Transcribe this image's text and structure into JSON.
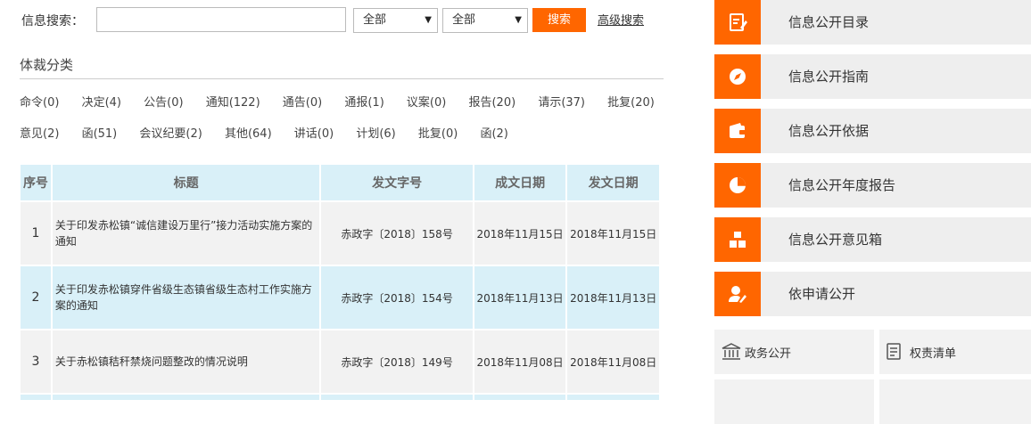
{
  "search": {
    "label": "信息搜索：",
    "input_value": "",
    "select1": "全部",
    "select2": "全部",
    "button": "搜索",
    "advanced": "高级搜索"
  },
  "section": {
    "title": "体裁分类"
  },
  "categories": {
    "row1": [
      "命令(0)",
      "决定(4)",
      "公告(0)",
      "通知(122)",
      "通告(0)",
      "通报(1)",
      "议案(0)",
      "报告(20)",
      "请示(37)",
      "批复(20)"
    ],
    "row2": [
      "意见(2)",
      "函(51)",
      "会议纪要(2)",
      "其他(64)",
      "讲话(0)",
      "计划(6)",
      "批复(0)",
      "函(2)"
    ]
  },
  "table": {
    "headers": [
      "序号",
      "标题",
      "发文字号",
      "成文日期",
      "发文日期"
    ],
    "rows": [
      {
        "num": "1",
        "title": "关于印发赤松镇“诚信建设万里行”接力活动实施方案的通知",
        "code": "赤政字〔2018〕158号",
        "written": "2018年11月15日",
        "issued": "2018年11月15日"
      },
      {
        "num": "2",
        "title": "关于印发赤松镇穿件省级生态镇省级生态村工作实施方案的通知",
        "code": "赤政字〔2018〕154号",
        "written": "2018年11月13日",
        "issued": "2018年11月13日"
      },
      {
        "num": "3",
        "title": "关于赤松镇秸秆禁烧问题整改的情况说明",
        "code": "赤政字〔2018〕149号",
        "written": "2018年11月08日",
        "issued": "2018年11月08日"
      }
    ]
  },
  "sidebar": {
    "items": [
      {
        "label": "信息公开目录",
        "icon": "edit-document-icon"
      },
      {
        "label": "信息公开指南",
        "icon": "compass-icon"
      },
      {
        "label": "信息公开依据",
        "icon": "wallet-icon"
      },
      {
        "label": "信息公开年度报告",
        "icon": "pie-chart-icon"
      },
      {
        "label": "信息公开意见箱",
        "icon": "boxes-icon"
      },
      {
        "label": "依申请公开",
        "icon": "user-edit-icon"
      }
    ],
    "quick_links": [
      {
        "label": "政务公开",
        "icon": "government-building-icon"
      },
      {
        "label": "权责清单",
        "icon": "list-document-icon"
      }
    ]
  },
  "colors": {
    "accent": "#ff6600",
    "table_header": "#d9f0f8",
    "row_gray": "#f2f2f2"
  }
}
